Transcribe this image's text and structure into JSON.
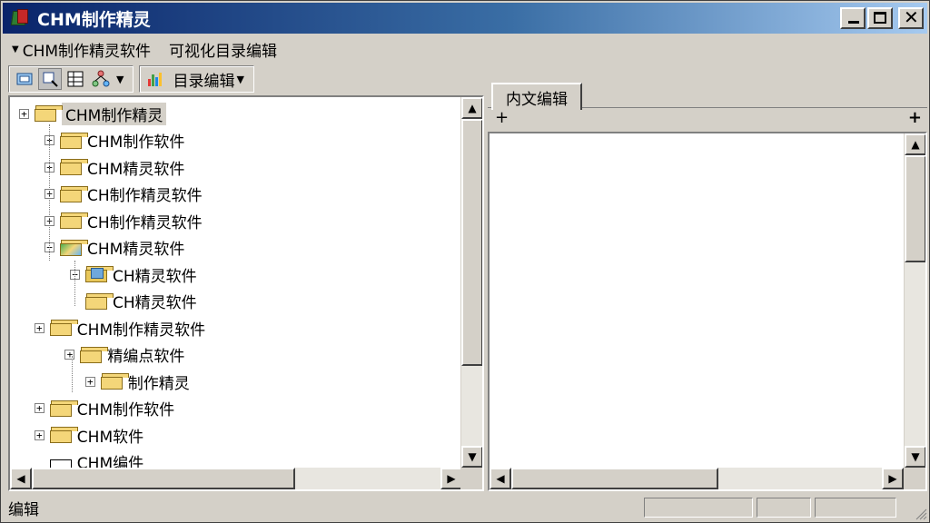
{
  "window": {
    "title": "CHM制作精灵"
  },
  "menubar": {
    "items": [
      "CHM制作精灵软件",
      "可视化目录编辑"
    ]
  },
  "toolbar": {
    "dropdown_label": "目录编辑"
  },
  "tree": {
    "nodes": [
      {
        "label": "CHM制作精灵",
        "level": 0,
        "expander": "+",
        "selected": true
      },
      {
        "label": "CHM制作软件",
        "level": 1,
        "expander": "+"
      },
      {
        "label": "CHM精灵软件",
        "level": 1,
        "expander": "+"
      },
      {
        "label": "CH制作精灵软件",
        "level": 1,
        "expander": "+"
      },
      {
        "label": "CH制作精灵软件",
        "level": 1,
        "expander": "+"
      },
      {
        "label": "CHM精灵软件",
        "level": 1,
        "expander": "-",
        "icon": "fancy"
      },
      {
        "label": "CH精灵软件",
        "level": 2,
        "expander": "-",
        "icon": "open"
      },
      {
        "label": "CH精灵软件",
        "level": 2,
        "expander": ""
      },
      {
        "label": "CHM制作精灵软件",
        "level": 0.6,
        "expander": "+"
      },
      {
        "label": "精编点软件",
        "level": 1.8,
        "expander": "+"
      },
      {
        "label": "制作精灵",
        "level": 2.6,
        "expander": "+"
      },
      {
        "label": "CHM制作软件",
        "level": 0.6,
        "expander": "+"
      },
      {
        "label": "CHM软件",
        "level": 0.6,
        "expander": "+"
      },
      {
        "label": "CHM编件",
        "level": 0.6,
        "expander": "",
        "icon": "empty"
      }
    ]
  },
  "content": {
    "tab_label": "内文编辑",
    "plus_left": "+",
    "plus_right": "+"
  },
  "statusbar": {
    "text": "编辑"
  }
}
